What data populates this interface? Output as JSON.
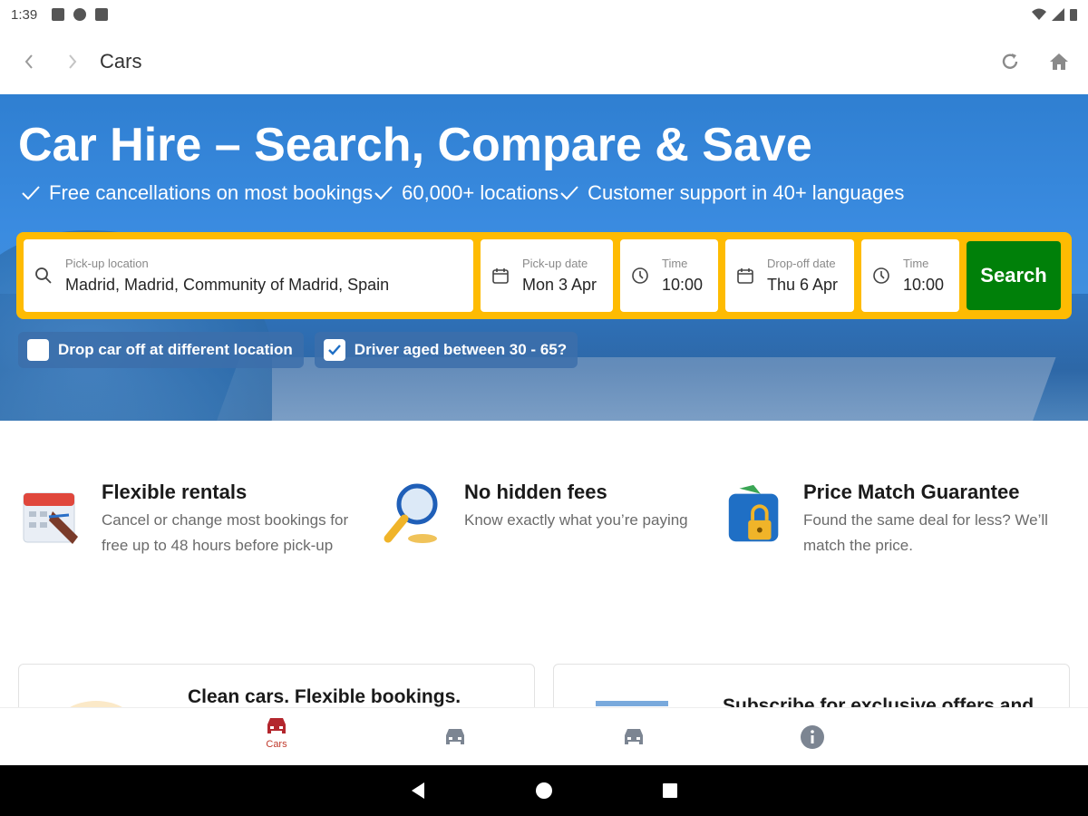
{
  "status_bar": {
    "time": "1:39"
  },
  "app_bar": {
    "title": "Cars"
  },
  "hero": {
    "title": "Car Hire – Search, Compare & Save",
    "features": [
      "Free cancellations on most bookings",
      "60,000+ locations",
      "Customer support in 40+ languages"
    ]
  },
  "search": {
    "location": {
      "label": "Pick-up location",
      "value": "Madrid, Madrid, Community of Madrid, Spain"
    },
    "pickup_date": {
      "label": "Pick-up date",
      "value": "Mon 3 Apr"
    },
    "pickup_time": {
      "label": "Time",
      "value": "10:00"
    },
    "dropoff_date": {
      "label": "Drop-off date",
      "value": "Thu 6 Apr"
    },
    "dropoff_time": {
      "label": "Time",
      "value": "10:00"
    },
    "button": "Search"
  },
  "options": {
    "different_location": {
      "label": "Drop car off at different location",
      "checked": false
    },
    "driver_age": {
      "label": "Driver aged between 30 - 65?",
      "checked": true
    }
  },
  "benefits": [
    {
      "title": "Flexible rentals",
      "text": "Cancel or change most bookings for free up to 48 hours before pick-up",
      "icon": "calendar-pen-icon"
    },
    {
      "title": "No hidden fees",
      "text": "Know exactly what you’re paying",
      "icon": "magnifier-icon"
    },
    {
      "title": "Price Match Guarantee",
      "text": "Found the same deal for less? We’ll match the price.",
      "icon": "wallet-lock-icon"
    }
  ],
  "cards": [
    {
      "title": "Clean cars. Flexible bookings."
    },
    {
      "title": "Subscribe for exclusive offers and"
    }
  ],
  "bottom_nav": {
    "cars_label": "Cars"
  },
  "colors": {
    "brand_blue": "#3a8be0",
    "search_yellow": "#febb02",
    "search_green": "#008009",
    "active_red": "#b3262d"
  }
}
